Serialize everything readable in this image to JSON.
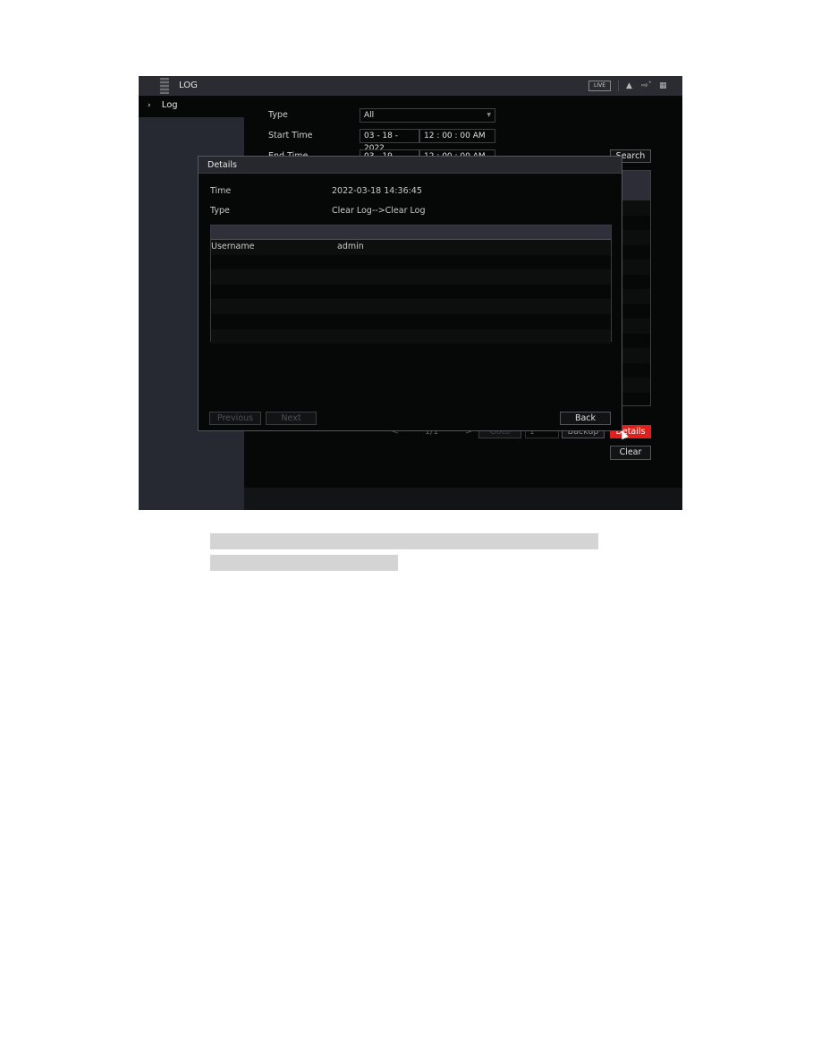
{
  "topbar": {
    "title": "LOG",
    "live_label": "LIVE",
    "icons": [
      "user-icon",
      "logout-icon",
      "grid-icon"
    ]
  },
  "sidebar": {
    "items": [
      {
        "label": "Log",
        "icon": "chevron-right-icon"
      }
    ]
  },
  "filters": {
    "type_label": "Type",
    "type_value": "All",
    "start_label": "Start Time",
    "start_date": "03 - 18 - 2022",
    "start_time": "12 : 00 : 00 AM",
    "end_label": "End Time",
    "end_date": "03 - 19 - 2022",
    "end_time": "12 : 00 : 00 AM",
    "search_label": "Search"
  },
  "pagination": {
    "prev": "<",
    "page": "1/1",
    "next": ">",
    "goto_label": "Goto",
    "goto_value": "1"
  },
  "actions": {
    "backup_label": "Backup",
    "details_label": "Details",
    "clear_label": "Clear"
  },
  "dialog": {
    "title": "Details",
    "time_label": "Time",
    "time_value": "2022-03-18 14:36:45",
    "type_label": "Type",
    "type_value": "Clear Log-->Clear Log",
    "rows": [
      {
        "key": "Username",
        "value": "admin"
      },
      {
        "key": "",
        "value": ""
      },
      {
        "key": "",
        "value": ""
      },
      {
        "key": "",
        "value": ""
      },
      {
        "key": "",
        "value": ""
      },
      {
        "key": "",
        "value": ""
      },
      {
        "key": "",
        "value": ""
      }
    ],
    "previous_label": "Previous",
    "next_label": "Next",
    "back_label": "Back"
  }
}
